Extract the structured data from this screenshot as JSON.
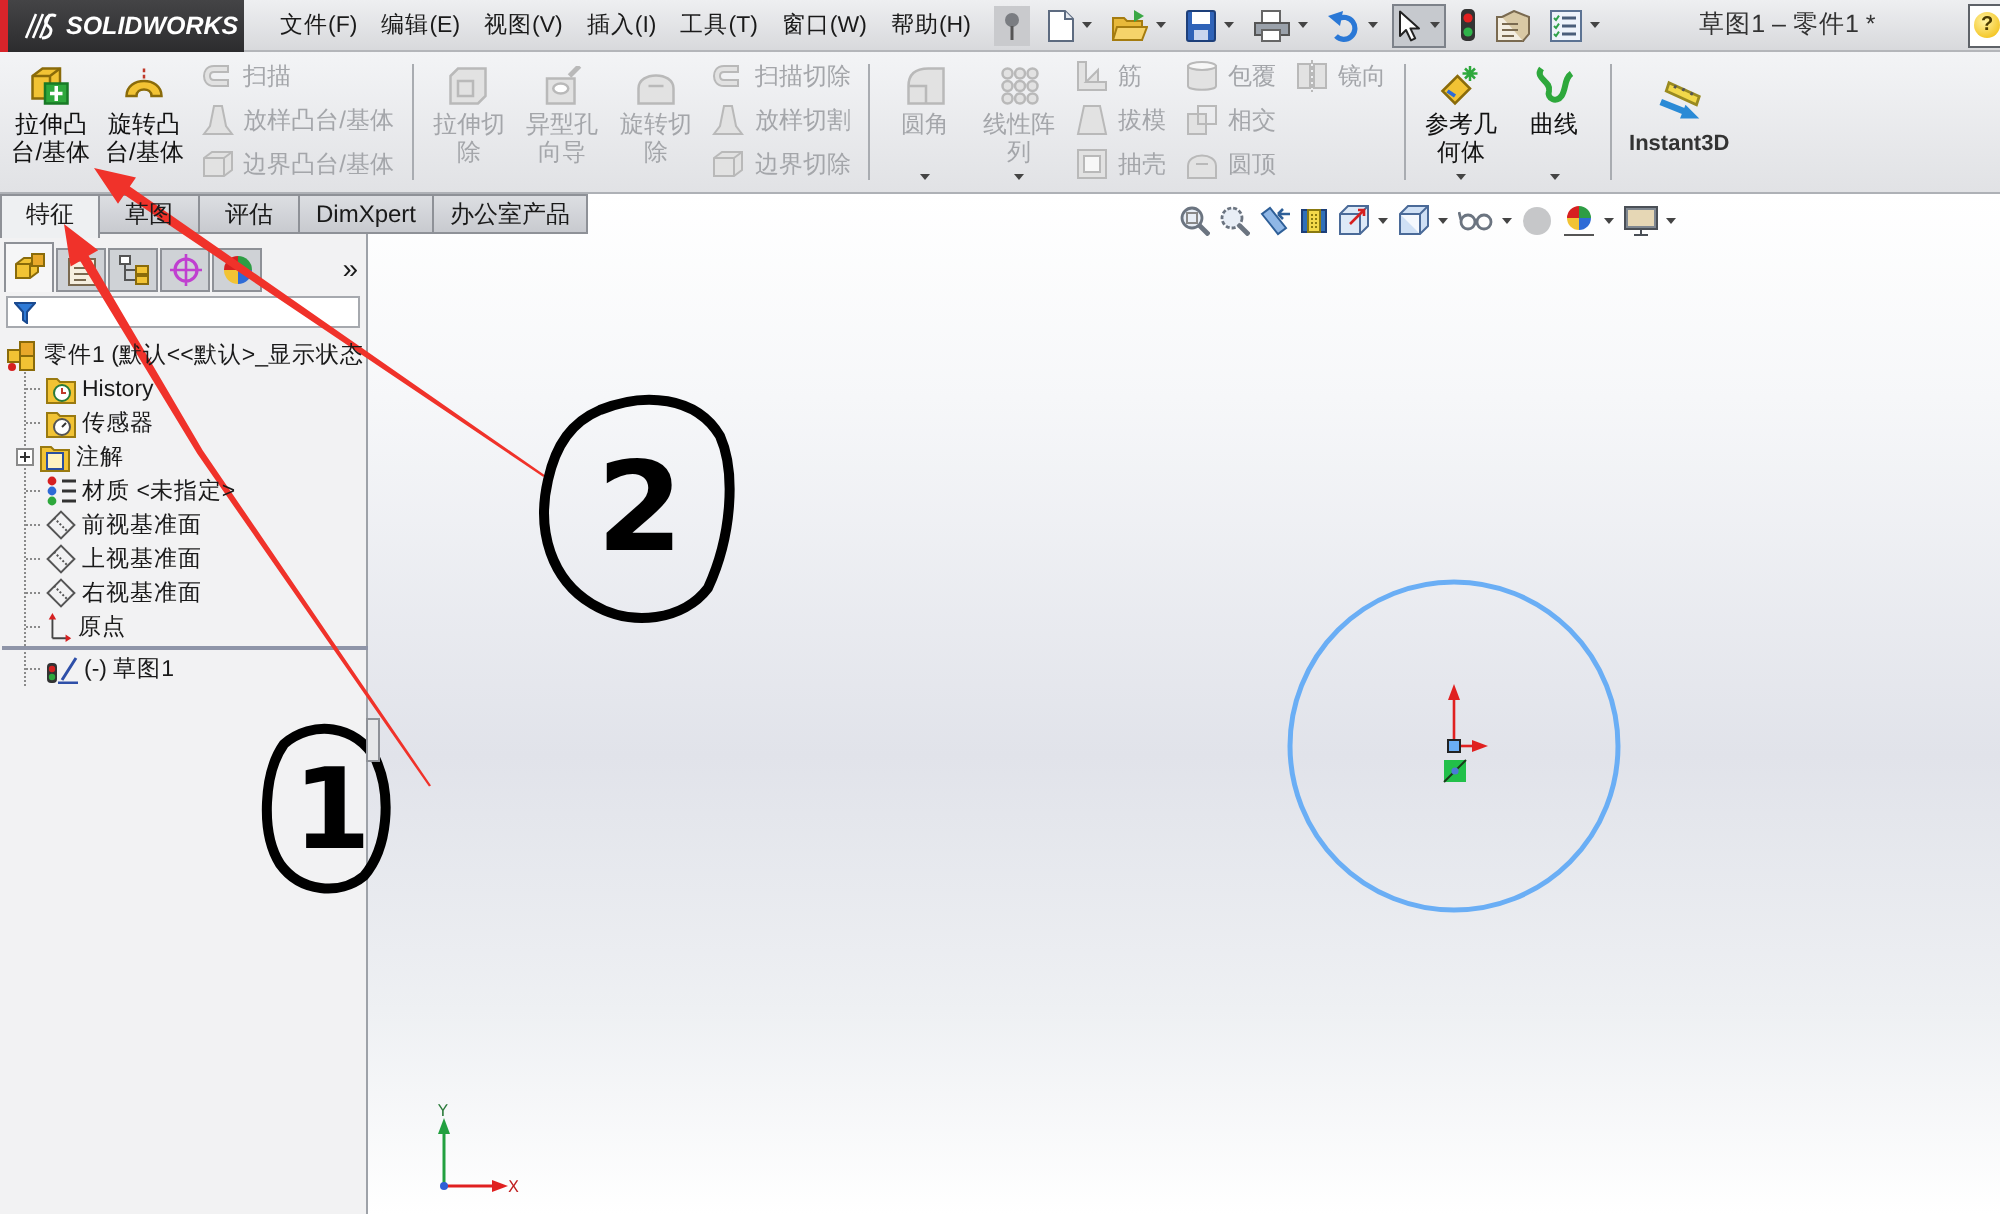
{
  "app_bar": {
    "logo": "SOLIDWORKS",
    "menu": [
      "文件(F)",
      "编辑(E)",
      "视图(V)",
      "插入(I)",
      "工具(T)",
      "窗口(W)",
      "帮助(H)"
    ],
    "title": "草图1 – 零件1 *",
    "help_button": "?"
  },
  "quick_toolbar": [
    {
      "kind": "new",
      "dropdown": true,
      "pressed": false
    },
    {
      "kind": "open",
      "dropdown": true,
      "pressed": false
    },
    {
      "kind": "save",
      "dropdown": true,
      "pressed": false
    },
    {
      "kind": "print",
      "dropdown": true,
      "pressed": false
    },
    {
      "kind": "undo",
      "dropdown": true,
      "pressed": false
    },
    {
      "kind": "select",
      "dropdown": true,
      "pressed": true
    },
    {
      "kind": "rebuild",
      "dropdown": false,
      "pressed": false
    },
    {
      "kind": "options",
      "dropdown": false,
      "pressed": false
    },
    {
      "kind": "properties",
      "dropdown": true,
      "pressed": false
    }
  ],
  "ribbon": [
    {
      "items": [
        {
          "kind": "large",
          "label": "拉伸凸台/基体",
          "disabled": false,
          "dropdown": false
        },
        {
          "kind": "large",
          "label": "旋转凸台/基体",
          "disabled": false,
          "dropdown": false
        },
        {
          "kind": "stack",
          "items": [
            {
              "label": "扫描",
              "disabled": true
            },
            {
              "label": "放样凸台/基体",
              "disabled": true
            },
            {
              "label": "边界凸台/基体",
              "disabled": true
            }
          ]
        }
      ]
    },
    {
      "items": [
        {
          "kind": "large",
          "label": "拉伸切除",
          "disabled": true,
          "dropdown": false
        },
        {
          "kind": "large",
          "label": "异型孔向导",
          "disabled": true,
          "dropdown": false
        },
        {
          "kind": "large",
          "label": "旋转切除",
          "disabled": true,
          "dropdown": false
        },
        {
          "kind": "stack",
          "items": [
            {
              "label": "扫描切除",
              "disabled": true
            },
            {
              "label": "放样切割",
              "disabled": true
            },
            {
              "label": "边界切除",
              "disabled": true
            }
          ]
        }
      ]
    },
    {
      "items": [
        {
          "kind": "large",
          "label": "圆角",
          "disabled": true,
          "dropdown": true
        },
        {
          "kind": "large",
          "label": "线性阵列",
          "disabled": true,
          "dropdown": true
        },
        {
          "kind": "stack",
          "items": [
            {
              "label": "筋",
              "disabled": true
            },
            {
              "label": "拔模",
              "disabled": true
            },
            {
              "label": "抽壳",
              "disabled": true
            }
          ]
        },
        {
          "kind": "stack",
          "items": [
            {
              "label": "包覆",
              "disabled": true
            },
            {
              "label": "相交",
              "disabled": true
            },
            {
              "label": "圆顶",
              "disabled": true
            }
          ]
        },
        {
          "kind": "stack",
          "items": [
            {
              "label": "镜向",
              "disabled": true
            }
          ]
        }
      ]
    },
    {
      "items": [
        {
          "kind": "large",
          "label": "参考几何体",
          "disabled": false,
          "dropdown": true
        },
        {
          "kind": "large",
          "label": "曲线",
          "disabled": false,
          "dropdown": true
        }
      ]
    },
    {
      "items": [
        {
          "kind": "toggle",
          "label": "Instant3D",
          "disabled": false
        }
      ]
    }
  ],
  "tabs": [
    {
      "label": "特征",
      "selected": true
    },
    {
      "label": "草图",
      "selected": false
    },
    {
      "label": "评估",
      "selected": false
    },
    {
      "label": "DimXpert",
      "selected": false
    },
    {
      "label": "办公室产品",
      "selected": false
    }
  ],
  "panel_tabs": [
    {
      "selected": true
    },
    {
      "selected": false
    },
    {
      "selected": false
    },
    {
      "selected": false
    },
    {
      "selected": false
    }
  ],
  "panel_more": "»",
  "tree": {
    "label": "零件1 (默认<<默认>_显示状态",
    "children": [
      {
        "kind": "history",
        "label": "History"
      },
      {
        "kind": "sensors",
        "label": "传感器"
      },
      {
        "kind": "annotations",
        "label": "注解",
        "expanded": false
      },
      {
        "kind": "material",
        "label": "材质 <未指定>"
      },
      {
        "kind": "plane",
        "label": "前视基准面"
      },
      {
        "kind": "plane",
        "label": "上视基准面"
      },
      {
        "kind": "plane",
        "label": "右视基准面"
      },
      {
        "kind": "origin",
        "label": "原点"
      },
      {
        "kind": "rollback_bar"
      },
      {
        "kind": "sketch",
        "label": "(-) 草图1"
      }
    ]
  },
  "view_toolbar": [
    {
      "kind": "zoom_fit",
      "dropdown": false
    },
    {
      "kind": "zoom_area",
      "dropdown": false
    },
    {
      "kind": "previous_view",
      "dropdown": false
    },
    {
      "kind": "section_view",
      "dropdown": false
    },
    {
      "kind": "view_orientation",
      "dropdown": true
    },
    {
      "kind": "display_style",
      "dropdown": true
    },
    {
      "kind": "hide_show",
      "dropdown": true
    },
    {
      "kind": "appearance",
      "dropdown": false
    },
    {
      "kind": "scene",
      "dropdown": true
    },
    {
      "kind": "view_settings",
      "dropdown": true
    }
  ],
  "sketch_entities": [
    {
      "kind": "circle"
    },
    {
      "kind": "origin"
    },
    {
      "kind": "point_marker"
    }
  ],
  "triad": {
    "y": "Y",
    "x": "X"
  },
  "annotations": [
    {
      "kind": "arrow"
    },
    {
      "kind": "arrow"
    },
    {
      "kind": "circled_number",
      "label": "2"
    },
    {
      "kind": "circled_number",
      "label": "1"
    }
  ]
}
